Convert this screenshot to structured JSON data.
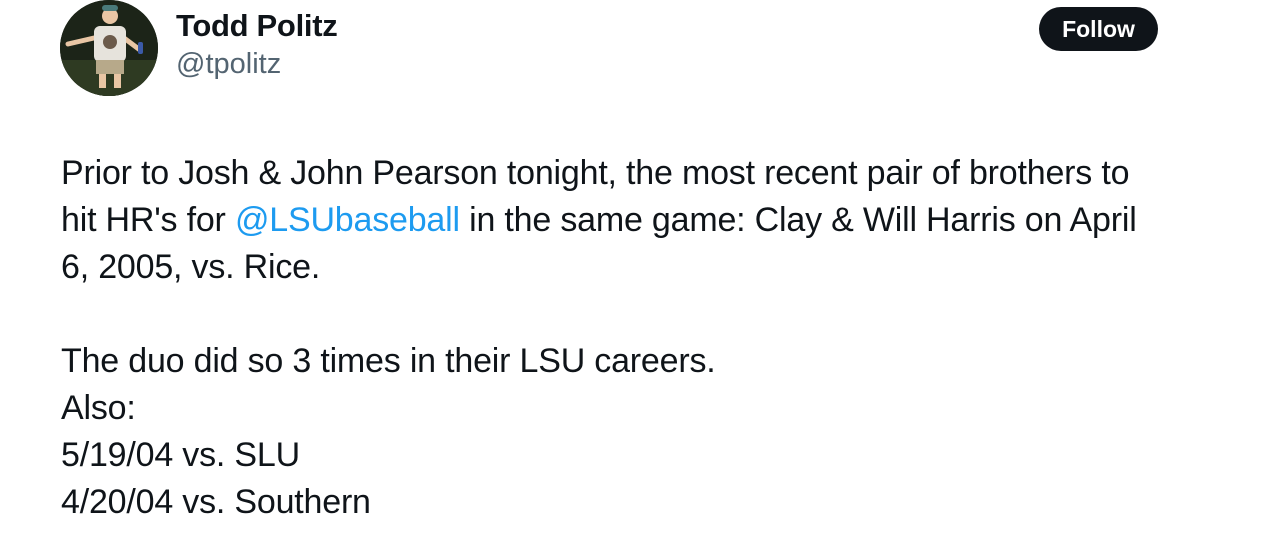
{
  "author": {
    "name": "Todd Politz",
    "handle": "@tpolitz",
    "avatar_icon": "profile-photo"
  },
  "follow_button": {
    "label": "Follow"
  },
  "tweet": {
    "line1": "Prior to Josh & John Pearson tonight, the most recent pair of brothers to",
    "line2_before": "hit HR's for ",
    "mention": "@LSUbaseball",
    "line2_after": " in the same game: Clay & Will Harris on April",
    "line3": "6, 2005, vs. Rice.",
    "line4": "The duo did so 3 times in their LSU careers.",
    "line5": "Also:",
    "line6": "5/19/04 vs. SLU",
    "line7": "4/20/04 vs. Southern"
  },
  "colors": {
    "text": "#0f1419",
    "secondary": "#536471",
    "link": "#1d9bf0",
    "button_bg": "#0f1419",
    "button_text": "#ffffff"
  }
}
